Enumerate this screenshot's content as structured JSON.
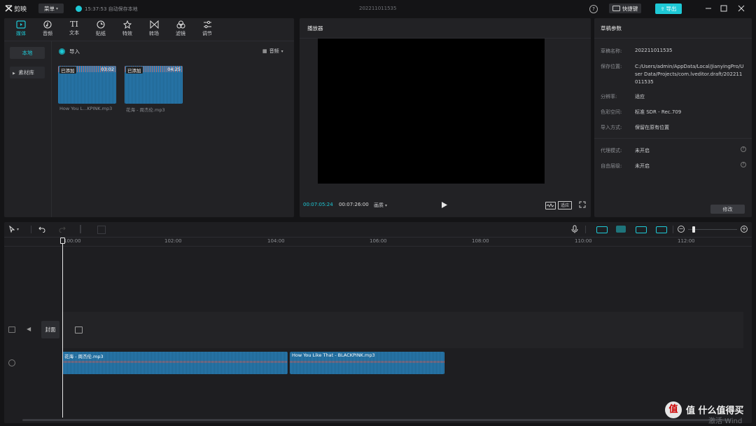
{
  "titlebar": {
    "app_name": "剪映",
    "menu_label": "菜单",
    "autosave_text": "15:37:53 自动保存本地",
    "project_title": "202211011535",
    "shortcut_label": "快捷键",
    "export_label": "导出"
  },
  "toolbar": {
    "tabs": [
      {
        "label": "媒体",
        "icon": "media-icon"
      },
      {
        "label": "音频",
        "icon": "audio-icon"
      },
      {
        "label": "文本",
        "icon": "text-icon",
        "glyph": "TI"
      },
      {
        "label": "贴纸",
        "icon": "sticker-icon"
      },
      {
        "label": "特效",
        "icon": "effects-icon"
      },
      {
        "label": "转场",
        "icon": "transition-icon"
      },
      {
        "label": "滤镜",
        "icon": "filter-icon"
      },
      {
        "label": "调节",
        "icon": "adjust-icon"
      }
    ]
  },
  "media": {
    "side_items": [
      "本地",
      "素材库"
    ],
    "import_label": "导入",
    "view_label": "音频",
    "clips": [
      {
        "badge": "已添加",
        "duration": "03:02",
        "name": "How You L...KPINK.mp3"
      },
      {
        "badge": "已添加",
        "duration": "04:25",
        "name": "花海 - 周杰伦.mp3"
      }
    ]
  },
  "player": {
    "title": "播放器",
    "current_time": "00:07:05:24",
    "total_time": "00:07:26:00",
    "quality_label": "画质",
    "ratio_label": "适应"
  },
  "draft": {
    "title": "草稿参数",
    "rows": [
      {
        "label": "草稿名称:",
        "value": "202211011535"
      },
      {
        "label": "保存位置:",
        "value": "C:/Users/admin/AppData/Local/JianyingPro/User Data/Projects/com.lveditor.draft/202211011535"
      },
      {
        "label": "分辨率:",
        "value": "适应"
      },
      {
        "label": "色彩空间:",
        "value": "标准 SDR - Rec.709"
      },
      {
        "label": "导入方式:",
        "value": "保留在原有位置"
      },
      {
        "label": "代理模式:",
        "value": "未开启"
      },
      {
        "label": "自由层级:",
        "value": "未开启"
      }
    ],
    "edit_label": "修改"
  },
  "timeline": {
    "ruler_labels": [
      "100:00",
      "102:00",
      "104:00",
      "106:00",
      "108:00",
      "110:00",
      "112:00"
    ],
    "cover_label": "封面",
    "audio_clips": [
      {
        "name": "花海 - 周杰伦.mp3"
      },
      {
        "name": "How You Like That - BLACKPINK.mp3"
      }
    ]
  },
  "watermark": {
    "site_name": "值 什么值得买",
    "windows_text": "激活 Wind"
  }
}
